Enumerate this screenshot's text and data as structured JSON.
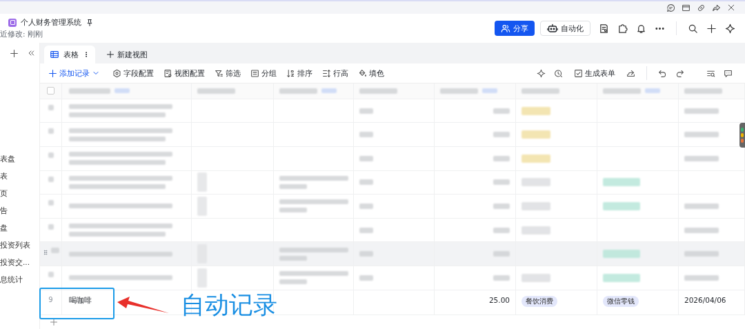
{
  "document": {
    "title": "个人财务管理系统",
    "last_modified": "近修改: 刚刚"
  },
  "header_buttons": [
    {
      "label": "分享",
      "kind": "primary"
    },
    {
      "label": "自动化",
      "kind": "secondary"
    }
  ],
  "sidebar": {
    "items": [
      {
        "label": "表盘"
      },
      {
        "label": "表"
      },
      {
        "label": "页"
      },
      {
        "label": "告"
      },
      {
        "label": "盘"
      },
      {
        "label": "投资列表"
      },
      {
        "label": "投资交..."
      },
      {
        "label": "息统计"
      }
    ]
  },
  "view_tabs": [
    {
      "label": "表格",
      "selected": true
    }
  ],
  "new_view": "新建视图",
  "toolbar": {
    "left": [
      {
        "label": "添加记录",
        "kind": "add"
      },
      {
        "label": "字段配置",
        "kind": "fields"
      },
      {
        "label": "视图配置",
        "kind": "view"
      },
      {
        "label": "筛选",
        "kind": "filter"
      },
      {
        "label": "分组",
        "kind": "group"
      },
      {
        "label": "排序",
        "kind": "sort"
      },
      {
        "label": "行高",
        "kind": "height"
      },
      {
        "label": "填色",
        "kind": "fill"
      }
    ],
    "right": [
      {
        "label": "生成表单",
        "kind": "form"
      }
    ]
  },
  "table": {
    "select_all": {
      "checked": false
    },
    "rows": [
      {
        "kind": "blurred",
        "highlighted": false
      },
      {
        "kind": "blurred",
        "highlighted": false
      },
      {
        "kind": "blurred",
        "highlighted": false
      },
      {
        "kind": "blurred",
        "highlighted": false
      },
      {
        "kind": "blurred",
        "highlighted": false
      },
      {
        "kind": "blurred",
        "highlighted": false
      },
      {
        "kind": "blurred",
        "highlighted": true
      },
      {
        "kind": "blurred",
        "highlighted": false
      },
      {
        "kind": "record",
        "highlighted": false,
        "number": "9",
        "name": "喝咖啡",
        "amount": "25.00",
        "category": "餐饮消费",
        "account": "微信零钱",
        "date": "2026/04/06"
      }
    ]
  },
  "annotation": {
    "text": "自动记录"
  }
}
